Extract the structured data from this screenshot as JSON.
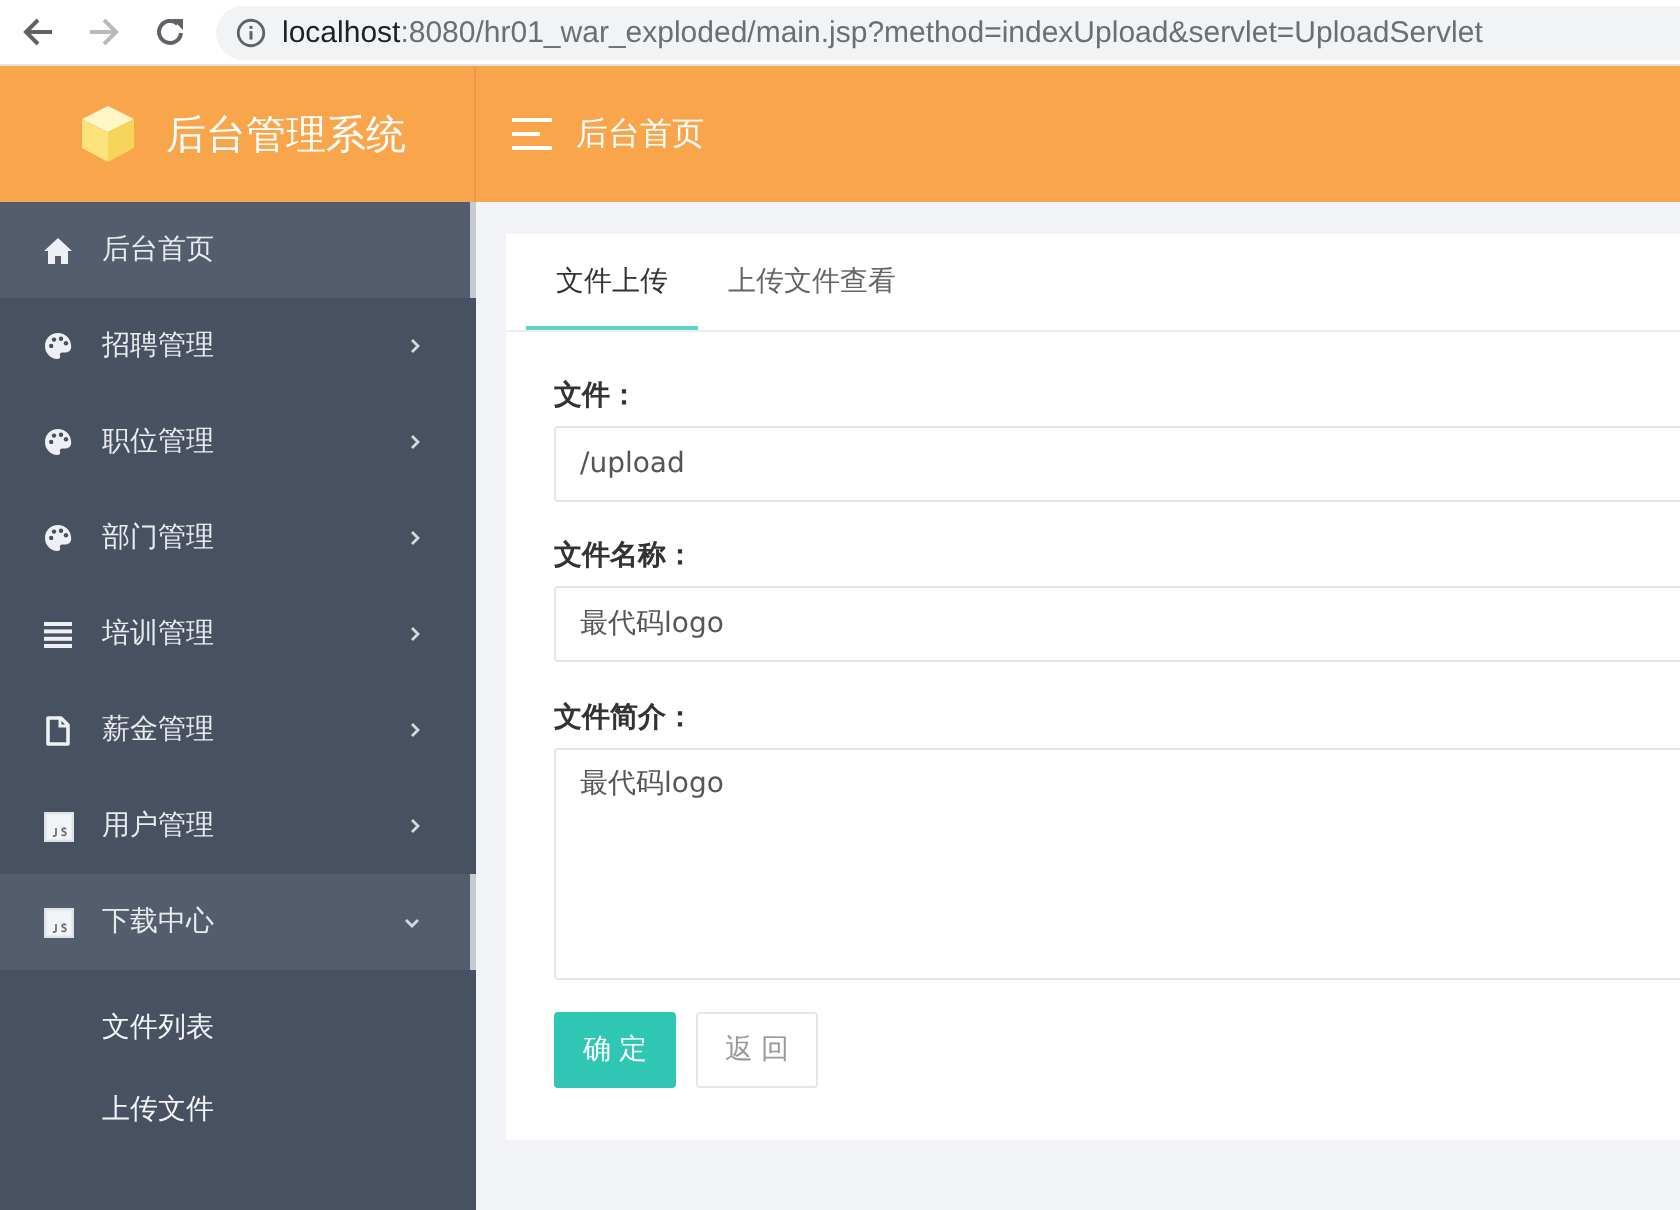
{
  "browser": {
    "nav": [
      {
        "kind": "back",
        "disabled": false
      },
      {
        "kind": "forward",
        "disabled": true
      },
      {
        "kind": "reload",
        "disabled": false
      }
    ],
    "url": {
      "host": "localhost",
      "path": ":8080/hr01_war_exploded/main.jsp?method=indexUpload&servlet=UploadServlet"
    }
  },
  "header": {
    "title": "后台管理系统",
    "breadcrumb": "后台首页"
  },
  "sidebar": {
    "items": [
      {
        "kind": "home",
        "label": "后台首页",
        "selected": true
      },
      {
        "kind": "palette",
        "label": "招聘管理",
        "selected": false,
        "expanded": false
      },
      {
        "kind": "palette",
        "label": "职位管理",
        "selected": false,
        "expanded": false
      },
      {
        "kind": "palette",
        "label": "部门管理",
        "selected": false,
        "expanded": false
      },
      {
        "kind": "list",
        "label": "培训管理",
        "selected": false,
        "expanded": false
      },
      {
        "kind": "document",
        "label": "薪金管理",
        "selected": false,
        "expanded": false
      },
      {
        "kind": "script",
        "label": "用户管理",
        "selected": false,
        "expanded": false
      },
      {
        "kind": "script",
        "label": "下载中心",
        "selected": true,
        "expanded": true,
        "children": [
          {
            "label": "文件列表",
            "selected": false
          },
          {
            "label": "上传文件",
            "selected": false
          }
        ]
      }
    ]
  },
  "tabs": [
    {
      "label": "文件上传",
      "selected": true
    },
    {
      "label": "上传文件查看",
      "selected": false
    }
  ],
  "form": {
    "fields": [
      {
        "kind": "input",
        "label": "文件：",
        "value": "/upload"
      },
      {
        "kind": "input",
        "label": "文件名称：",
        "value": "最代码logo"
      },
      {
        "kind": "textarea",
        "label": "文件简介：",
        "value": "最代码logo"
      }
    ],
    "buttons": [
      {
        "kind": "primary",
        "label": "确 定"
      },
      {
        "kind": "default",
        "label": "返 回"
      }
    ]
  }
}
